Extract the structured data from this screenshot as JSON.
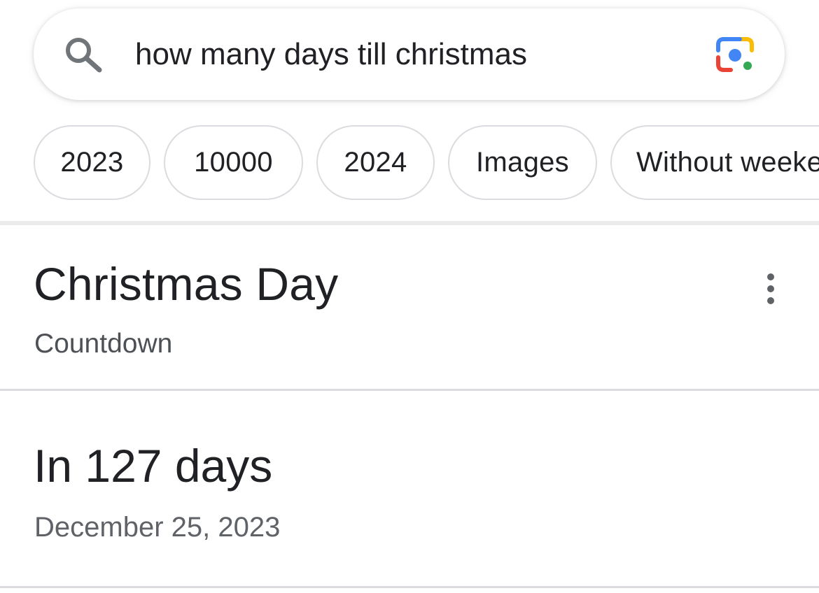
{
  "search": {
    "query": "how many days till christmas",
    "icon": "search-icon",
    "lens_icon": "google-lens-icon"
  },
  "chips": [
    {
      "label": "2023"
    },
    {
      "label": "10000"
    },
    {
      "label": "2024"
    },
    {
      "label": "Images"
    },
    {
      "label": "Without weekends"
    }
  ],
  "result": {
    "title": "Christmas Day",
    "subtitle": "Countdown",
    "more_icon": "more-vert-icon",
    "countdown": "In 127 days",
    "date": "December 25, 2023"
  },
  "colors": {
    "text_primary": "#202124",
    "text_secondary": "#5f6368",
    "google_blue": "#4285F4",
    "google_red": "#EA4335",
    "google_yellow": "#FBBC04",
    "google_green": "#34A853"
  }
}
